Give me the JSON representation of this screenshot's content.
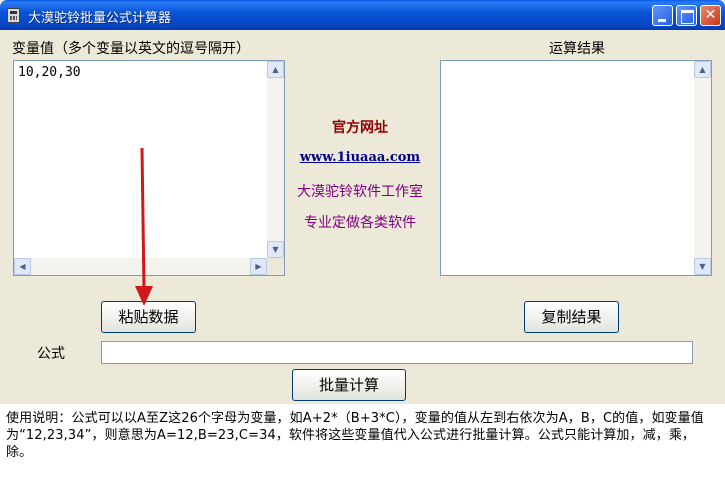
{
  "window": {
    "title": "大漠驼铃批量公式计算器",
    "icon": "calculator-icon"
  },
  "variables": {
    "label": "变量值（多个变量以英文的逗号隔开）",
    "value": "10,20,30"
  },
  "results": {
    "label": "运算结果",
    "value": ""
  },
  "promo": {
    "official_site_label": "官方网址",
    "url": "www.1iuaaa.com",
    "studio": "大漠驼铃软件工作室",
    "custom_software": "专业定做各类软件"
  },
  "buttons": {
    "paste_data": "粘贴数据",
    "copy_result": "复制结果",
    "batch_calculate": "批量计算"
  },
  "formula": {
    "label": "公式",
    "value": ""
  },
  "instructions": "使用说明：公式可以以A至Z这26个字母为变量，如A+2*（B+3*C），变量的值从左到右依次为A，B，C的值，如变量值为“12,23,34”，则意思为A=12,B=23,C=34，软件将这些变量值代入公式进行批量计算。公式只能计算加，减，乘，除。",
  "colors": {
    "titlebar": "#0a55d8",
    "window_bg": "#ece9d8",
    "promo_title": "#8b0000",
    "promo_url": "#00008b",
    "promo_text": "#800080",
    "arrow": "#d01818"
  }
}
